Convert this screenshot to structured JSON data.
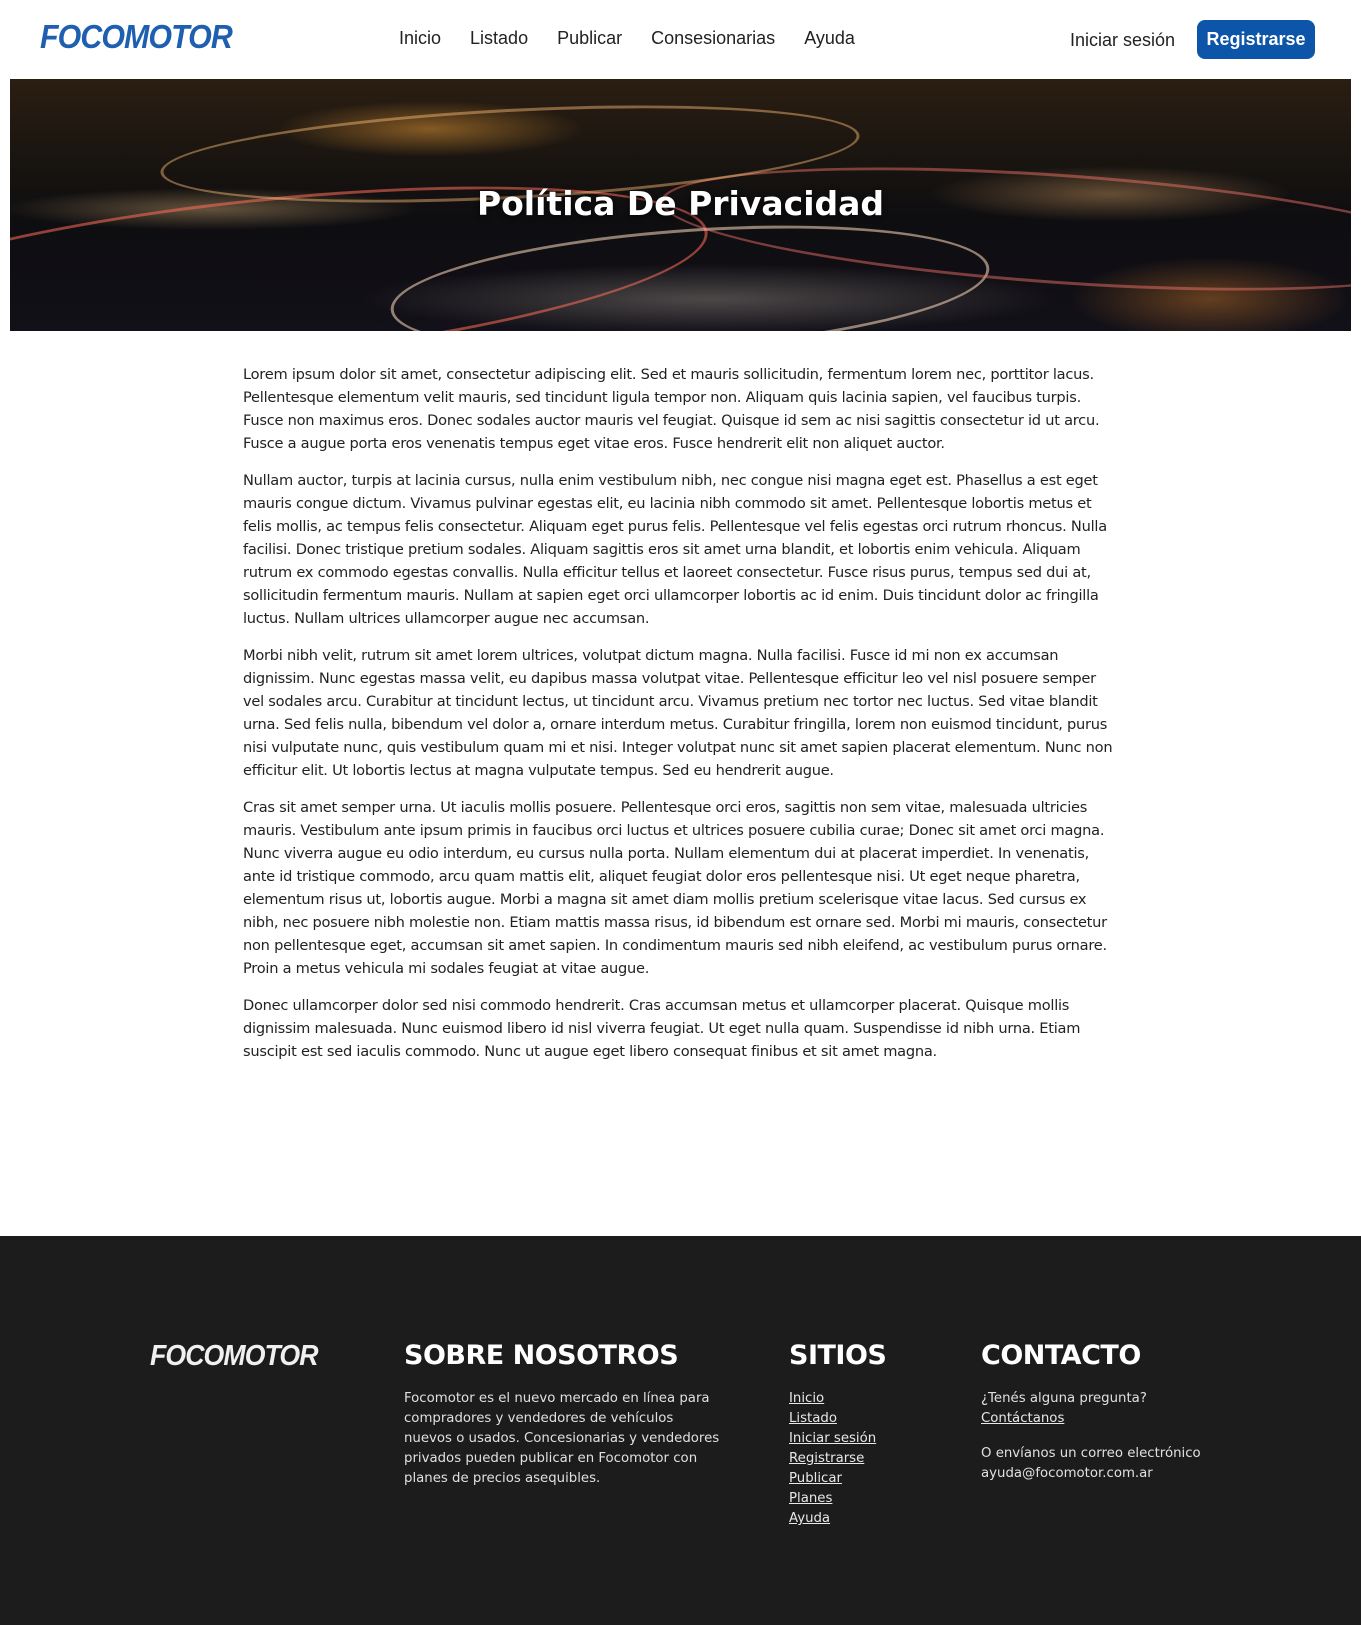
{
  "header": {
    "logo": "FOCOMOTOR",
    "nav": [
      "Inicio",
      "Listado",
      "Publicar",
      "Consesionarias",
      "Ayuda"
    ],
    "login": "Iniciar sesión",
    "register": "Registrarse",
    "brand_color": "#0d55a8"
  },
  "hero": {
    "title": "Política De Privacidad"
  },
  "content": {
    "paragraphs": [
      "Lorem ipsum dolor sit amet, consectetur adipiscing elit. Sed et mauris sollicitudin, fermentum lorem nec, porttitor lacus. Pellentesque elementum velit mauris, sed tincidunt ligula tempor non. Aliquam quis lacinia sapien, vel faucibus turpis. Fusce non maximus eros. Donec sodales auctor mauris vel feugiat. Quisque id sem ac nisi sagittis consectetur id ut arcu. Fusce a augue porta eros venenatis tempus eget vitae eros. Fusce hendrerit elit non aliquet auctor.",
      "Nullam auctor, turpis at lacinia cursus, nulla enim vestibulum nibh, nec congue nisi magna eget est. Phasellus a est eget mauris congue dictum. Vivamus pulvinar egestas elit, eu lacinia nibh commodo sit amet. Pellentesque lobortis metus et felis mollis, ac tempus felis consectetur. Aliquam eget purus felis. Pellentesque vel felis egestas orci rutrum rhoncus. Nulla facilisi. Donec tristique pretium sodales. Aliquam sagittis eros sit amet urna blandit, et lobortis enim vehicula. Aliquam rutrum ex commodo egestas convallis. Nulla efficitur tellus et laoreet consectetur. Fusce risus purus, tempus sed dui at, sollicitudin fermentum mauris. Nullam at sapien eget orci ullamcorper lobortis ac id enim. Duis tincidunt dolor ac fringilla luctus. Nullam ultrices ullamcorper augue nec accumsan.",
      "Morbi nibh velit, rutrum sit amet lorem ultrices, volutpat dictum magna. Nulla facilisi. Fusce id mi non ex accumsan dignissim. Nunc egestas massa velit, eu dapibus massa volutpat vitae. Pellentesque efficitur leo vel nisl posuere semper vel sodales arcu. Curabitur at tincidunt lectus, ut tincidunt arcu. Vivamus pretium nec tortor nec luctus. Sed vitae blandit urna. Sed felis nulla, bibendum vel dolor a, ornare interdum metus. Curabitur fringilla, lorem non euismod tincidunt, purus nisi vulputate nunc, quis vestibulum quam mi et nisi. Integer volutpat nunc sit amet sapien placerat elementum. Nunc non efficitur elit. Ut lobortis lectus at magna vulputate tempus. Sed eu hendrerit augue.",
      "Cras sit amet semper urna. Ut iaculis mollis posuere. Pellentesque orci eros, sagittis non sem vitae, malesuada ultricies mauris. Vestibulum ante ipsum primis in faucibus orci luctus et ultrices posuere cubilia curae; Donec sit amet orci magna. Nunc viverra augue eu odio interdum, eu cursus nulla porta. Nullam elementum dui at placerat imperdiet. In venenatis, ante id tristique commodo, arcu quam mattis elit, aliquet feugiat dolor eros pellentesque nisi. Ut eget neque pharetra, elementum risus ut, lobortis augue. Morbi a magna sit amet diam mollis pretium scelerisque vitae lacus. Sed cursus ex nibh, nec posuere nibh molestie non. Etiam mattis massa risus, id bibendum est ornare sed. Morbi mi mauris, consectetur non pellentesque eget, accumsan sit amet sapien. In condimentum mauris sed nibh eleifend, ac vestibulum purus ornare. Proin a metus vehicula mi sodales feugiat at vitae augue.",
      "Donec ullamcorper dolor sed nisi commodo hendrerit. Cras accumsan metus et ullamcorper placerat. Quisque mollis dignissim malesuada. Nunc euismod libero id nisl viverra feugiat. Ut eget nulla quam. Suspendisse id nibh urna. Etiam suscipit est sed iaculis commodo. Nunc ut augue eget libero consequat finibus et sit amet magna."
    ]
  },
  "footer": {
    "logo": "FOCOMOTOR",
    "about": {
      "title": "SOBRE NOSOTROS",
      "text": "Focomotor es el nuevo mercado en línea para compradores y vendedores de vehículos nuevos o usados. Concesionarias y vendedores privados pueden publicar en Focomotor con planes de precios asequibles."
    },
    "sites": {
      "title": "SITIOS",
      "links": [
        "Inicio",
        "Listado",
        "Iniciar sesión",
        "Registrarse",
        "Publicar",
        "Planes",
        "Ayuda"
      ]
    },
    "contact": {
      "title": "CONTACTO",
      "question": "¿Tenés alguna pregunta?",
      "contact_link": "Contáctanos",
      "email_intro": "O envíanos un correo electrónico",
      "email": "ayuda@focomotor.com.ar"
    },
    "background": "#1c1c1c"
  }
}
